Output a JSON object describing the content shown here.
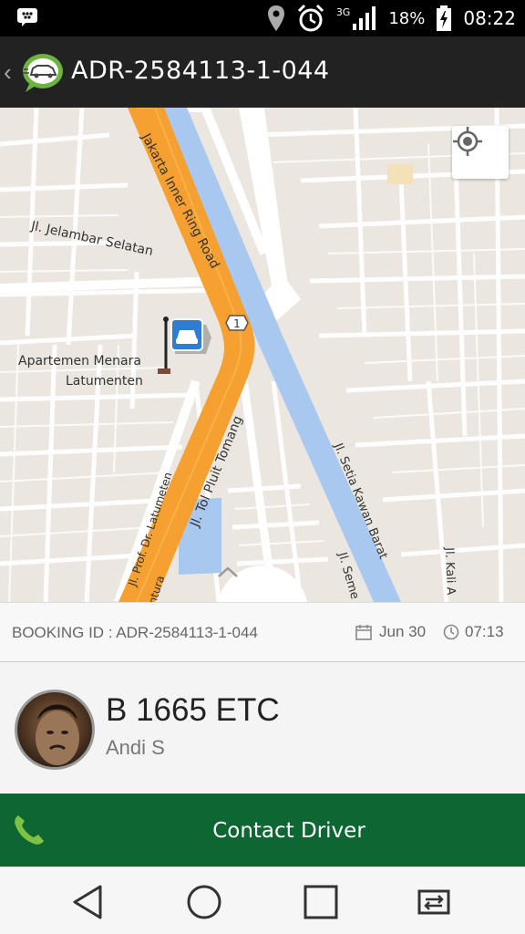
{
  "status_bar": {
    "network": "3G",
    "battery_text": "18%",
    "time": "08:22"
  },
  "app_bar": {
    "title": "ADR-2584113-1-044"
  },
  "map": {
    "labels": {
      "jelambar": "Jl. Jelambar Selatan",
      "inner_ring": "Jakarta Inner Ring Road",
      "apartemen_1": "Apartemen Menara",
      "apartemen_2": "Latumenten",
      "tol": "Jl. Tol Pluit Tomang",
      "latumeten": "Jl. Prof. Dr. Latumeten",
      "setia": "Jl. Setia Kawan Barat",
      "seme": "Jl. Seme",
      "kali": "Jl. Kali A",
      "antura": "ntura",
      "route_number": "1"
    }
  },
  "booking": {
    "id_text": "BOOKING ID : ADR-2584113-1-044",
    "date": "Jun 30",
    "time": "07:13"
  },
  "driver": {
    "plate": "B 1665 ETC",
    "name": "Andi S"
  },
  "contact": {
    "label": "Contact Driver"
  },
  "colors": {
    "app_bar": "#222222",
    "contact_button": "#0e6633",
    "highway": "#f5a030",
    "river": "#a8c8f0",
    "map_background": "#ebe7e0"
  }
}
